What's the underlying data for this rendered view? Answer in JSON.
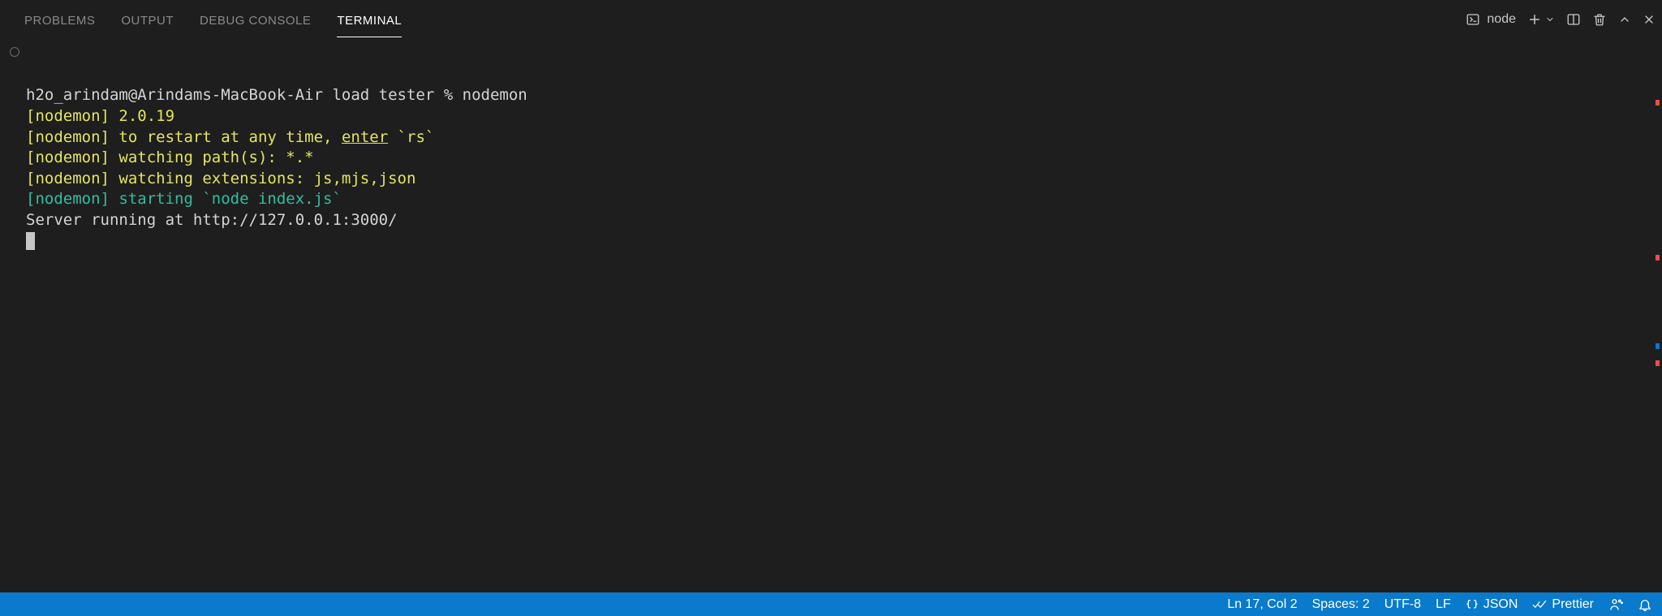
{
  "panel": {
    "tabs": [
      {
        "label": "PROBLEMS"
      },
      {
        "label": "OUTPUT"
      },
      {
        "label": "DEBUG CONSOLE"
      },
      {
        "label": "TERMINAL"
      }
    ],
    "active_tab_index": 3,
    "terminal_profile_label": "node"
  },
  "terminal": {
    "prompt": "h2o_arindam@Arindams-MacBook-Air load tester % nodemon",
    "lines": {
      "version": "[nodemon] 2.0.19",
      "restart_prefix": "[nodemon] to restart at any time, ",
      "restart_enter": "enter",
      "restart_suffix": " `rs`",
      "paths": "[nodemon] watching path(s): *.*",
      "exts": "[nodemon] watching extensions: js,mjs,json",
      "starting": "[nodemon] starting `node index.js`",
      "server": "Server running at http://127.0.0.1:3000/"
    }
  },
  "statusbar": {
    "cursor": "Ln 17, Col 2",
    "spaces": "Spaces: 2",
    "encoding": "UTF-8",
    "eol": "LF",
    "language": "JSON",
    "formatter": "Prettier"
  },
  "overview_marks": [
    {
      "top_pct": 11,
      "color": "#f14c4c"
    },
    {
      "top_pct": 39,
      "color": "#f14c4c"
    },
    {
      "top_pct": 55,
      "color": "#007acc"
    },
    {
      "top_pct": 58,
      "color": "#f14c4c"
    }
  ]
}
